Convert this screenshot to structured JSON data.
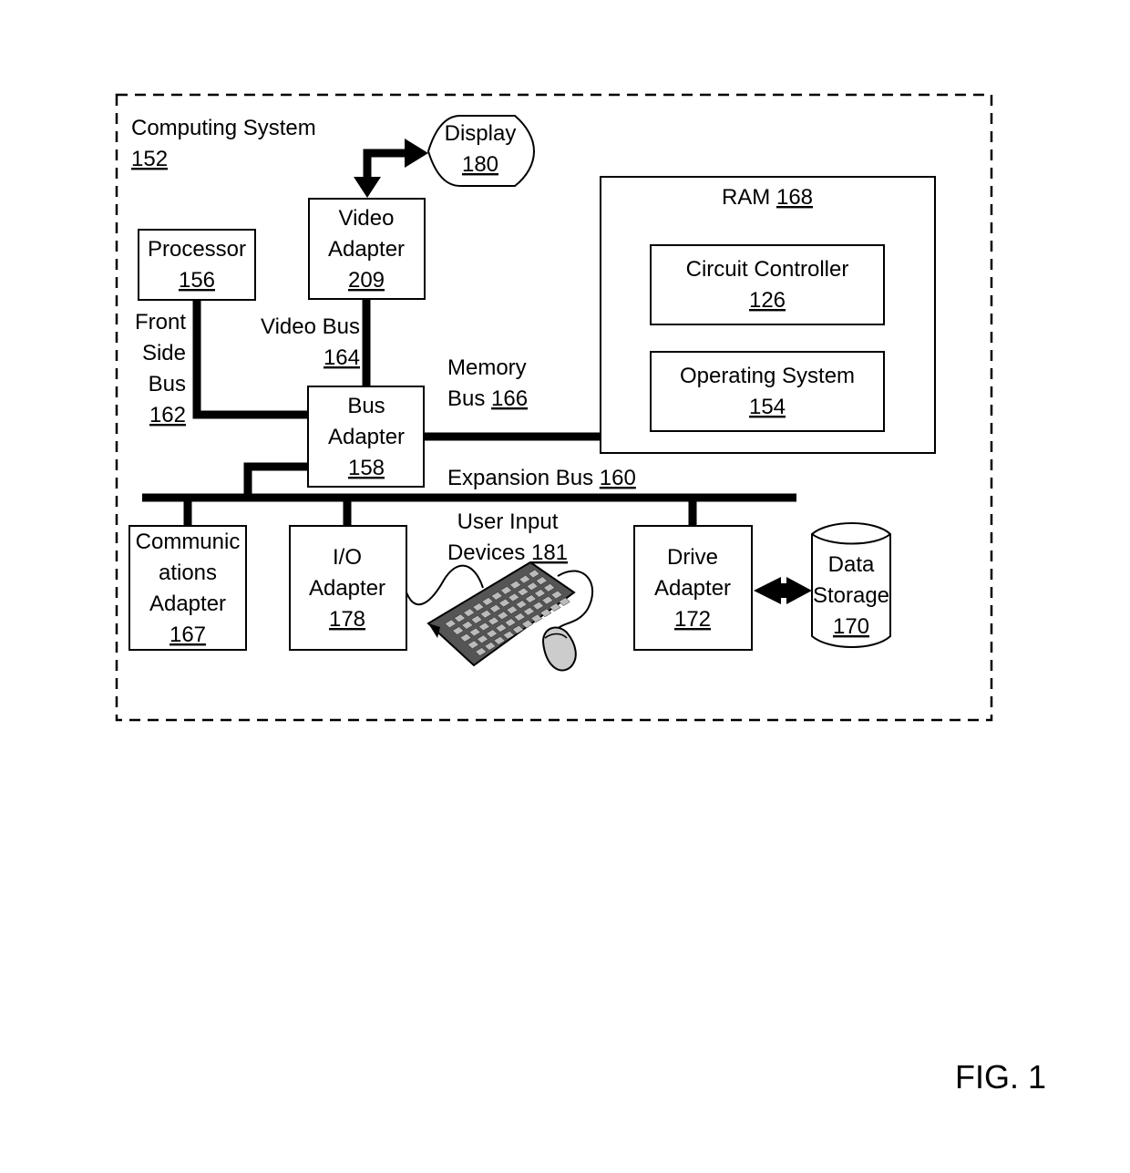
{
  "figure": {
    "label": "FIG. 1"
  },
  "system": {
    "name": "Computing System",
    "ref": "152"
  },
  "display": {
    "name": "Display",
    "ref": "180"
  },
  "video_adapter": {
    "line1": "Video",
    "line2": "Adapter",
    "ref": "209"
  },
  "processor": {
    "name": "Processor",
    "ref": "156"
  },
  "ram": {
    "name": "RAM",
    "ref": "168"
  },
  "circuit_controller": {
    "name": "Circuit Controller",
    "ref": "126"
  },
  "operating_system": {
    "name": "Operating System",
    "ref": "154"
  },
  "front_side_bus": {
    "line1": "Front",
    "line2": "Side",
    "line3": "Bus",
    "ref": "162"
  },
  "video_bus": {
    "name": "Video Bus",
    "ref": "164"
  },
  "memory_bus": {
    "line1": "Memory",
    "line2": "Bus",
    "ref": "166"
  },
  "bus_adapter": {
    "line1": "Bus",
    "line2": "Adapter",
    "ref": "158"
  },
  "expansion_bus": {
    "name": "Expansion Bus",
    "ref": "160"
  },
  "comm_adapter": {
    "line1": "Communic",
    "line2": "ations",
    "line3": "Adapter",
    "ref": "167"
  },
  "io_adapter": {
    "line1": "I/O",
    "line2": "Adapter",
    "ref": "178"
  },
  "user_input": {
    "line1": "User Input",
    "line2": "Devices",
    "ref": "181"
  },
  "drive_adapter": {
    "line1": "Drive",
    "line2": "Adapter",
    "ref": "172"
  },
  "data_storage": {
    "line1": "Data",
    "line2": "Storage",
    "ref": "170"
  }
}
